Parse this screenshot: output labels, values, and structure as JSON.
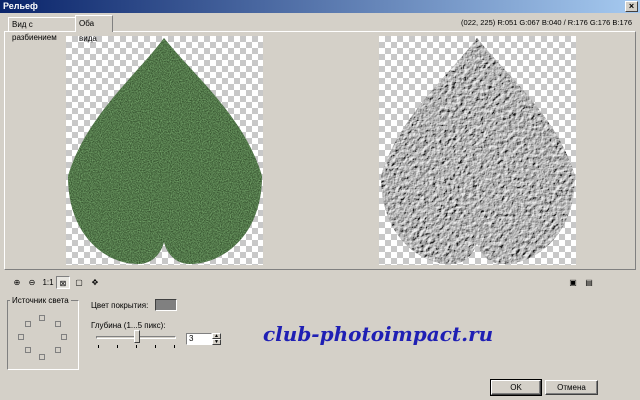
{
  "window": {
    "title": "Рельеф",
    "close_glyph": "×"
  },
  "tabs": [
    {
      "label": "Вид с разбиением"
    },
    {
      "label": "Оба вида"
    }
  ],
  "readout": "(022, 225) R:051 G:067 B:040 / R:176 G:176 B:176",
  "zoom_toolbar": {
    "zoom_in_icon": "⊕",
    "zoom_out_icon": "⊖",
    "actual_size_label": "1:1",
    "fit_icon": "⊠",
    "preview_icon": "▢",
    "pan_icon": "✥",
    "right_icon_1": "▣",
    "right_icon_2": "▤"
  },
  "light_source": {
    "label": "Источник света"
  },
  "fill_color": {
    "label": "Цвет покрытия:",
    "value": "#808080"
  },
  "depth": {
    "label": "Глубина (1...5 пикс):",
    "value": "3",
    "min": 1,
    "max": 5
  },
  "watermark": "club-photoimpact.ru",
  "buttons": {
    "ok": "OK",
    "cancel": "Отмена"
  },
  "colors": {
    "title_start": "#0a246a",
    "title_end": "#a6caf0",
    "dialog_bg": "#d4d0c8",
    "watermark": "#1f1fb4"
  }
}
